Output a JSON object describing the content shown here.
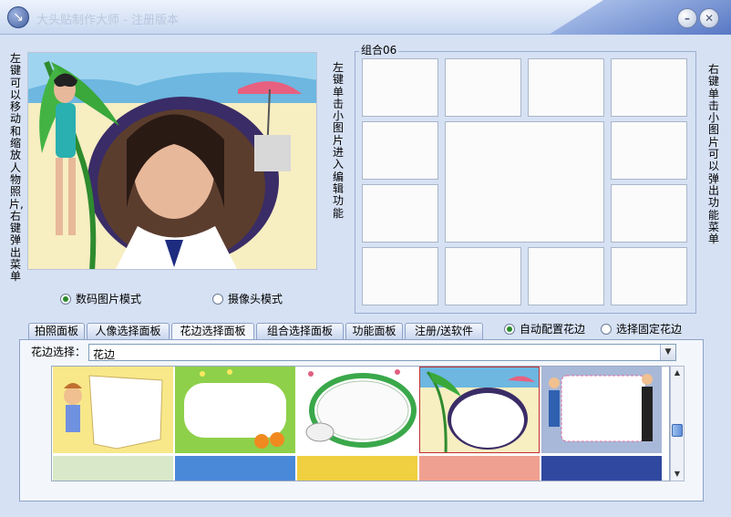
{
  "window": {
    "title": "大头贴制作大师 - 注册版本",
    "minimize_glyph": "–",
    "close_glyph": "✕",
    "app_icon": "↘"
  },
  "hints": {
    "left": "左键可以移动和缩放人物照片,右键弹出菜单",
    "middle": "左键单击小图片进入编辑功能",
    "right": "右键单击小图片可以弹出功能菜单"
  },
  "modes": {
    "digital": "数码图片模式",
    "camera": "摄像头模式",
    "selected": "digital"
  },
  "group": {
    "legend": "组合06"
  },
  "tabs": [
    "拍照面板",
    "人像选择面板",
    "花边选择面板",
    "组合选择面板",
    "功能面板",
    "注册/送软件"
  ],
  "active_tab": 2,
  "border_modes": {
    "auto": "自动配置花边",
    "fixed": "选择固定花边",
    "selected": "auto"
  },
  "border_select": {
    "label": "花边选择：",
    "value": "花边"
  },
  "icons": {
    "dropdown": "chevron-down-icon",
    "scroll_up": "arrow-up-icon",
    "scroll_down": "arrow-down-icon"
  },
  "colors": {
    "window_bg": "#d6e1f4",
    "accent": "#5877c4",
    "panel_bg": "#f3f6fb"
  }
}
